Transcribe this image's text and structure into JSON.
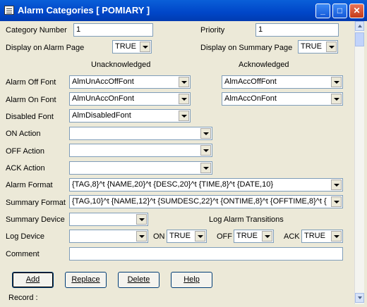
{
  "window": {
    "title": "Alarm Categories [ POMIARY ]"
  },
  "fields": {
    "category_number_label": "Category Number",
    "category_number": "1",
    "priority_label": "Priority",
    "priority": "1",
    "display_alarm_page_label": "Display on Alarm Page",
    "display_alarm_page": "TRUE",
    "display_summary_page_label": "Display on Summary Page",
    "display_summary_page": "TRUE",
    "unack_header": "Unacknowledged",
    "ack_header": "Acknowledged",
    "alarm_off_font_label": "Alarm Off Font",
    "alarm_off_font_unack": "AlmUnAccOffFont",
    "alarm_off_font_ack": "AlmAccOffFont",
    "alarm_on_font_label": "Alarm On Font",
    "alarm_on_font_unack": "AlmUnAccOnFont",
    "alarm_on_font_ack": "AlmAccOnFont",
    "disabled_font_label": "Disabled Font",
    "disabled_font": "AlmDisabledFont",
    "on_action_label": "ON Action",
    "on_action": "",
    "off_action_label": "OFF Action",
    "off_action": "",
    "ack_action_label": "ACK Action",
    "ack_action": "",
    "alarm_format_label": "Alarm Format",
    "alarm_format": "{TAG,8}^t {NAME,20}^t {DESC,20}^t {TIME,8}^t {DATE,10}",
    "summary_format_label": "Summary Format",
    "summary_format": "{TAG,10}^t {NAME,12}^t {SUMDESC,22}^t {ONTIME,8}^t {OFFTIME,8}^t {",
    "summary_device_label": "Summary Device",
    "summary_device": "",
    "log_transitions_header": "Log Alarm Transitions",
    "log_device_label": "Log Device",
    "log_device": "",
    "on_label": "ON",
    "on_value": "TRUE",
    "off_label": "OFF",
    "off_value": "TRUE",
    "ack_label": "ACK",
    "ack_value": "TRUE",
    "comment_label": "Comment",
    "comment": ""
  },
  "buttons": {
    "add": "Add",
    "replace": "Replace",
    "delete": "Delete",
    "help": "Help"
  },
  "status": {
    "record": "Record :"
  },
  "titlebar_buttons": {
    "minimize": "_",
    "maximize": "□",
    "close": "✕"
  }
}
